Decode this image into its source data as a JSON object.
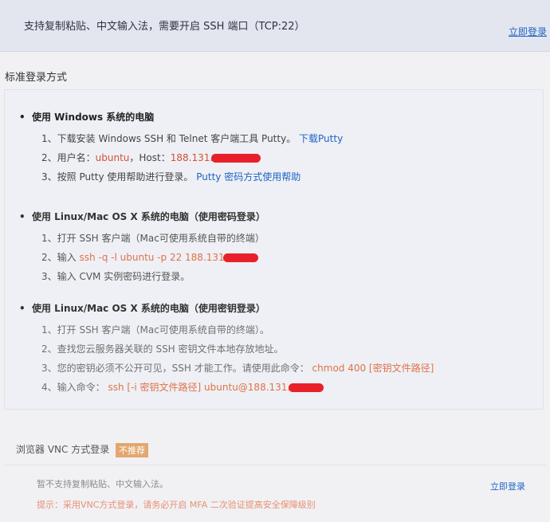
{
  "banner": {
    "notice": "支持复制粘贴、中文输入法，需要开启 SSH 端口（TCP:22）",
    "login_label": "立即登录"
  },
  "section_title": "标准登录方式",
  "groups": [
    {
      "title": "使用 Windows 系统的电脑",
      "steps": {
        "s1_text": "1、下载安装 Windows SSH 和 Telnet 客户端工具 Putty。",
        "s1_link": "下载Putty",
        "s2_prefix": "2、用户名：",
        "s2_user": "ubuntu",
        "s2_mid": "，Host：",
        "s2_host": "188.131.",
        "s3_text": "3、按照 Putty 使用帮助进行登录。",
        "s3_link": "Putty 密码方式使用帮助"
      }
    },
    {
      "title": "使用 Linux/Mac OS X 系统的电脑（使用密码登录）",
      "steps": {
        "s1_text": "1、打开 SSH 客户端（Mac可使用系统自带的终端）",
        "s2_prefix": "2、输入",
        "s2_cmd": "ssh -q -l ubuntu -p 22 188.131",
        "s3_text": "3、输入 CVM 实例密码进行登录。"
      }
    },
    {
      "title": "使用 Linux/Mac OS X 系统的电脑（使用密钥登录）",
      "steps": {
        "s1_text": "1、打开 SSH 客户端（Mac可使用系统自带的终端）。",
        "s2_text": "2、查找您云服务器关联的 SSH 密钥文件本地存放地址。",
        "s3_prefix": "3、您的密钥必须不公开可见，SSH 才能工作。请使用此命令：",
        "s3_cmd": "chmod 400 [密钥文件路径]",
        "s4_prefix": "4、输入命令：",
        "s4_cmd": "ssh [-i 密钥文件路径] ubuntu@188.131."
      }
    }
  ],
  "vnc": {
    "title": "浏览器 VNC 方式登录",
    "badge": "不推荐",
    "note1": "暂不支持复制粘贴、中文输入法。",
    "login_label": "立即登录",
    "note2": "提示：采用VNC方式登录，请务必开启 MFA 二次验证提高安全保障级别"
  },
  "colors": {
    "link": "#1f63c7",
    "highlight": "#d35232",
    "badge": "#e2a76f",
    "redaction": "#e8202a"
  }
}
